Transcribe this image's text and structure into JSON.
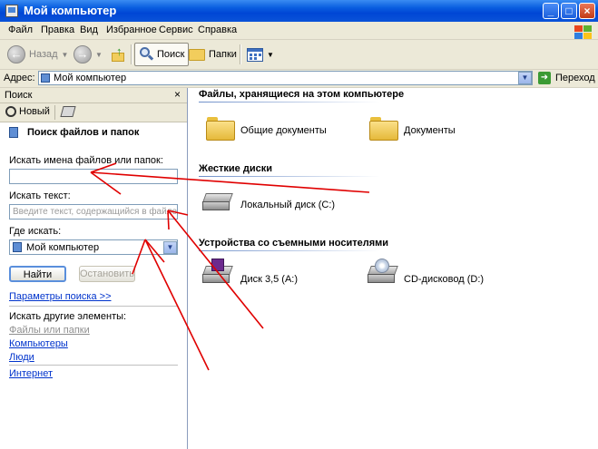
{
  "window": {
    "title": "Мой компьютер"
  },
  "menu": [
    "Файл",
    "Правка",
    "Вид",
    "Избранное",
    "Сервис",
    "Справка"
  ],
  "toolbar": {
    "back_label": "Назад",
    "search_label": "Поиск",
    "folders_label": "Папки"
  },
  "address": {
    "label": "Адрес:",
    "value": "Мой компьютер",
    "go_label": "Переход"
  },
  "search_pane": {
    "title": "Поиск",
    "new_label": "Новый",
    "heading": "Поиск файлов и папок",
    "name_label": "Искать имена файлов или папок:",
    "name_value": "",
    "text_label": "Искать текст:",
    "text_placeholder": "Введите текст, содержащийся в файле.",
    "where_label": "Где искать:",
    "where_value": "Мой компьютер",
    "find_button": "Найти",
    "stop_button": "Остановить",
    "params_link": "Параметры поиска >>",
    "other_label": "Искать другие элементы:",
    "other_links": [
      "Файлы или папки",
      "Компьютеры",
      "Люди",
      "Интернет"
    ]
  },
  "content": {
    "groups": [
      {
        "title": "Файлы, хранящиеся на этом компьютере",
        "items": [
          "Общие документы",
          "Документы"
        ]
      },
      {
        "title": "Жесткие диски",
        "items": [
          "Локальный диск (C:)"
        ]
      },
      {
        "title": "Устройства со съемными носителями",
        "items": [
          "Диск 3,5 (A:)",
          "CD-дисковод (D:)"
        ]
      }
    ]
  },
  "colors": {
    "title_bar": "#0a53d8",
    "annotation_arrow": "#e00000",
    "link": "#0033cc"
  }
}
